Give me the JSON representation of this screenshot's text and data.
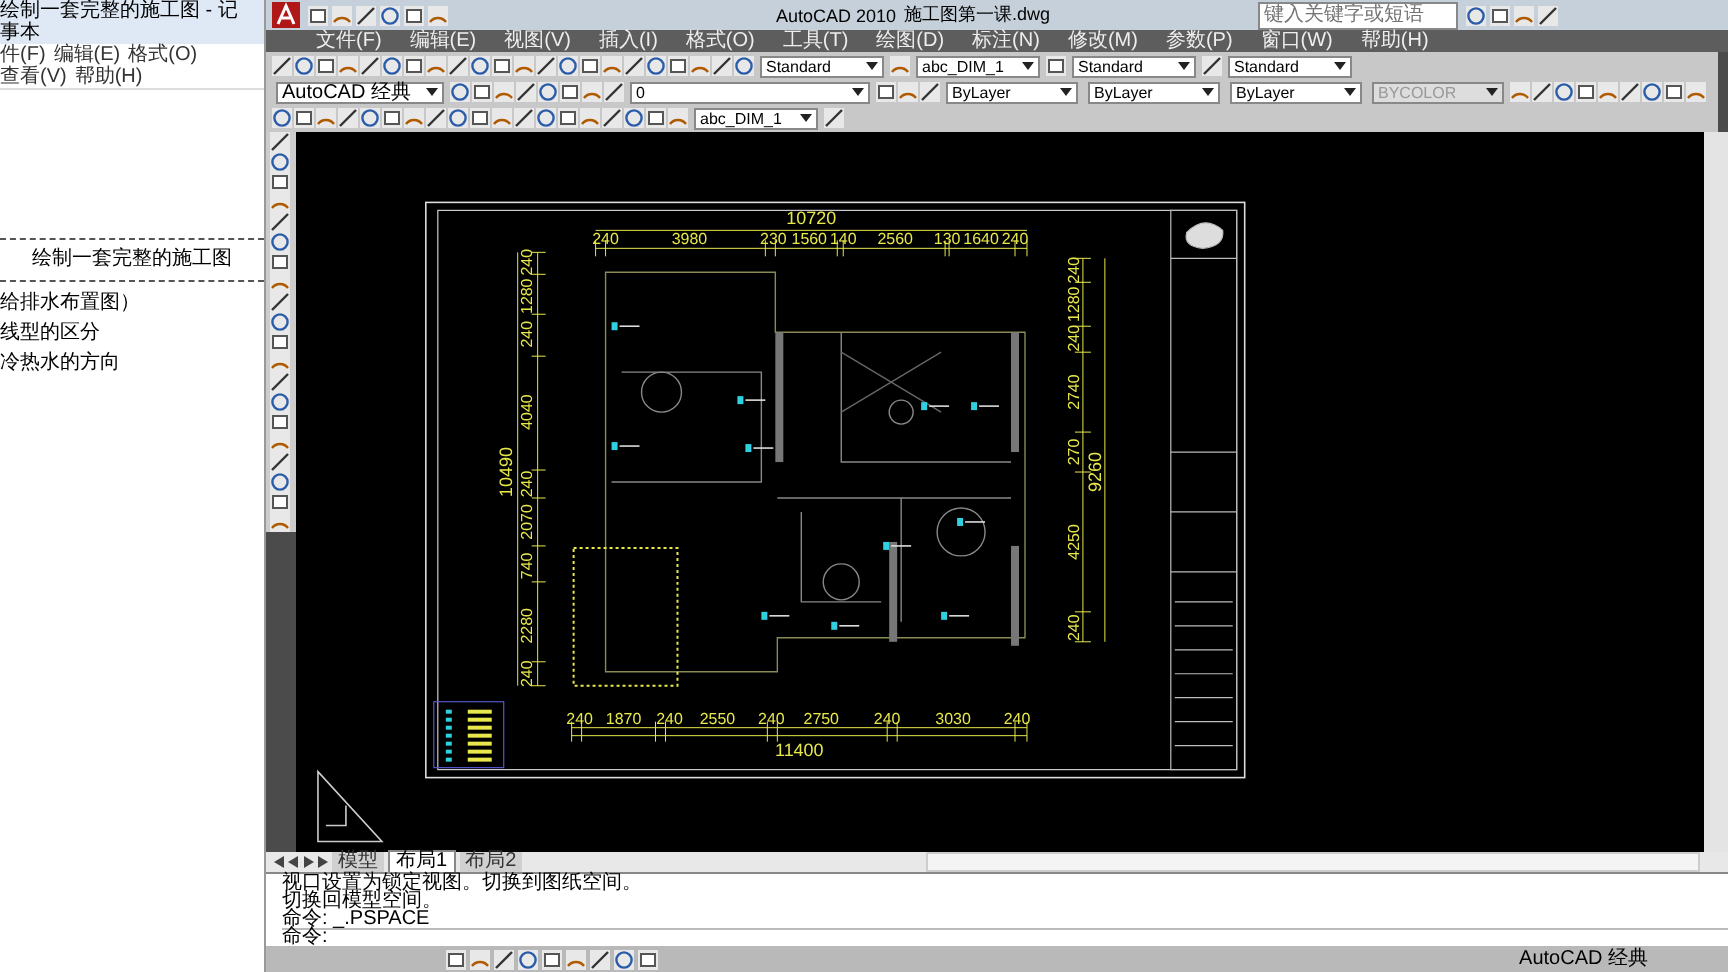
{
  "notepad": {
    "title": "绘制一套完整的施工图 - 记事本",
    "menu": [
      "件(F)",
      "编辑(E)",
      "格式(O)",
      "查看(V)",
      "帮助(H)"
    ],
    "heading": "绘制一套完整的施工图",
    "lines": [
      "给排水布置图）",
      "线型的区分",
      "冷热水的方向"
    ]
  },
  "autocad": {
    "app_title": "AutoCAD 2010",
    "file_name": "施工图第一课.dwg",
    "search": {
      "placeholder": "键入关键字或短语"
    },
    "menu": [
      "文件(F)",
      "编辑(E)",
      "视图(V)",
      "插入(I)",
      "格式(O)",
      "工具(T)",
      "绘图(D)",
      "标注(N)",
      "修改(M)",
      "参数(P)",
      "窗口(W)",
      "帮助(H)"
    ],
    "styles_toolbar": [
      "Standard",
      "abc_DIM_1",
      "Standard",
      "Standard"
    ],
    "workspace": "AutoCAD 经典",
    "layer": "0",
    "properties": [
      {
        "value": "ByLayer",
        "disabled": false
      },
      {
        "value": "ByLayer",
        "disabled": false
      },
      {
        "value": "ByLayer",
        "disabled": false
      },
      {
        "value": "BYCOLOR",
        "disabled": true
      }
    ],
    "dim_style": "abc_DIM_1",
    "drawing": {
      "top_total": "10720",
      "top_dims": [
        "240",
        "3980",
        "230",
        "1560",
        "140",
        "2560",
        "130",
        "1640",
        "240"
      ],
      "bottom_total": "11400",
      "bottom_dims": [
        "240",
        "1870",
        "240",
        "2550",
        "240",
        "2750",
        "240",
        "3030",
        "240"
      ],
      "left_total": "10490",
      "left_dims": [
        "240",
        "1280",
        "240",
        "4040",
        "240",
        "2070",
        "740",
        "2280",
        "240"
      ],
      "right_total": "9260",
      "right_dims": [
        "240",
        "1280",
        "240",
        "2740",
        "270",
        "4250",
        "240"
      ]
    },
    "layout_tabs": [
      {
        "label": "模型",
        "selected": false
      },
      {
        "label": "布局1",
        "selected": true
      },
      {
        "label": "布局2",
        "selected": false
      }
    ],
    "command_history": [
      "视口设置为锁定视图。切换到图纸空间。",
      "切换回模型空间。",
      "命令: _.PSPACE"
    ],
    "command_prompt": "命令:",
    "status_workspace": "AutoCAD 经典"
  }
}
